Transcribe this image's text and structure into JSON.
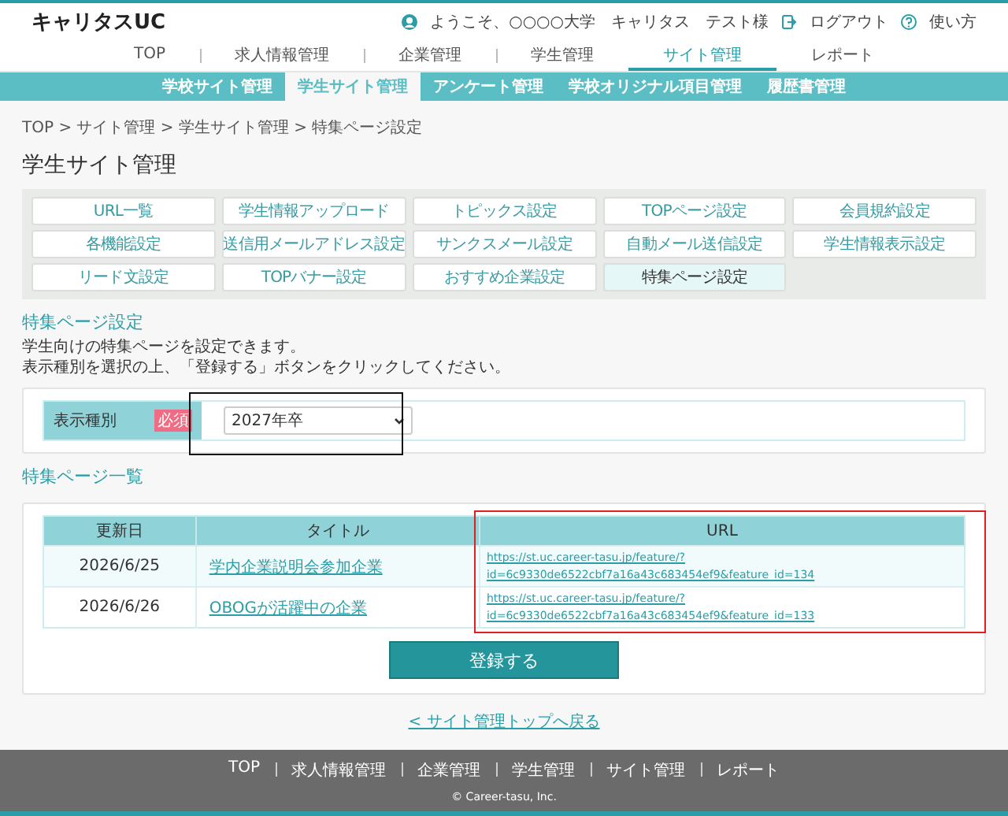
{
  "header": {
    "logo": "キャリタスUC",
    "welcome": "ようこそ、○○○○大学　キャリタス　テスト様",
    "logout": "ログアウト",
    "help": "使い方"
  },
  "nav": [
    {
      "label": "TOP",
      "selected": false
    },
    {
      "label": "求人情報管理",
      "selected": false
    },
    {
      "label": "企業管理",
      "selected": false
    },
    {
      "label": "学生管理",
      "selected": false
    },
    {
      "label": "サイト管理",
      "selected": true
    },
    {
      "label": "レポート",
      "selected": false
    }
  ],
  "subnav": [
    {
      "label": "学校サイト管理",
      "selected": false
    },
    {
      "label": "学生サイト管理",
      "selected": true
    },
    {
      "label": "アンケート管理",
      "selected": false
    },
    {
      "label": "学校オリジナル項目管理",
      "selected": false
    },
    {
      "label": "履歴書管理",
      "selected": false
    }
  ],
  "breadcrumb": "TOP > サイト管理 > 学生サイト管理 > 特集ページ設定",
  "page_title": "学生サイト管理",
  "menu": [
    {
      "label": "URL一覧",
      "selected": false
    },
    {
      "label": "学生情報アップロード",
      "selected": false
    },
    {
      "label": "トピックス設定",
      "selected": false
    },
    {
      "label": "TOPページ設定",
      "selected": false
    },
    {
      "label": "会員規約設定",
      "selected": false
    },
    {
      "label": "各機能設定",
      "selected": false
    },
    {
      "label": "送信用メールアドレス設定",
      "selected": false
    },
    {
      "label": "サンクスメール設定",
      "selected": false
    },
    {
      "label": "自動メール送信設定",
      "selected": false
    },
    {
      "label": "学生情報表示設定",
      "selected": false
    },
    {
      "label": "リード文設定",
      "selected": false
    },
    {
      "label": "TOPバナー設定",
      "selected": false
    },
    {
      "label": "おすすめ企業設定",
      "selected": false
    },
    {
      "label": "特集ページ設定",
      "selected": true
    }
  ],
  "section": {
    "heading": "特集ページ設定",
    "description": [
      "学生向けの特集ページを設定できます。",
      "表示種別を選択の上、「登録する」ボタンをクリックしてください。"
    ]
  },
  "form": {
    "label": "表示種別",
    "required": "必須",
    "value": "2027年卒",
    "highlighted": true
  },
  "list": {
    "heading": "特集ページ一覧",
    "columns": [
      "更新日",
      "タイトル",
      "URL"
    ],
    "url_highlighted": true,
    "rows": [
      {
        "date": "2026/6/25",
        "title": "学内企業説明会参加企業",
        "url": [
          "https://st.uc.career-tasu.jp/feature/?",
          "id=6c9330de6522cbf7a16a43c683454ef9&feature_id=134"
        ]
      },
      {
        "date": "2026/6/26",
        "title": "OBOGが活躍中の企業",
        "url": [
          "https://st.uc.career-tasu.jp/feature/?",
          "id=6c9330de6522cbf7a16a43c683454ef9&feature_id=133"
        ]
      }
    ]
  },
  "submit": "登録する",
  "back_link": "< サイト管理トップへ戻る",
  "footer": {
    "links": [
      "TOP",
      "求人情報管理",
      "企業管理",
      "学生管理",
      "サイト管理",
      "レポート"
    ],
    "copyright": "© Career-tasu, Inc."
  }
}
